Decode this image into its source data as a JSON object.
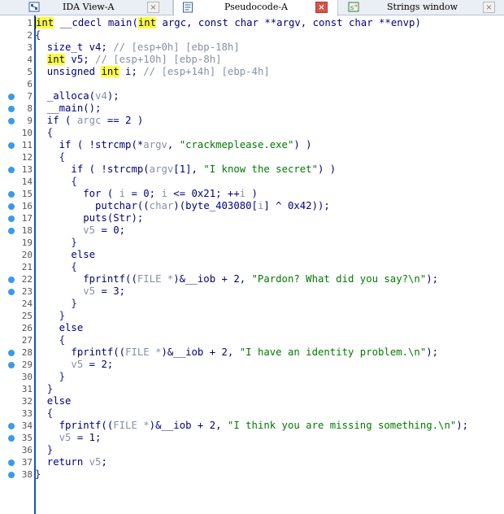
{
  "tabs": [
    {
      "label": "IDA View-A",
      "icon": "ida-view-icon",
      "active": false
    },
    {
      "label": "Pseudocode-A",
      "icon": "pseudocode-icon",
      "active": true
    },
    {
      "label": "Strings window",
      "icon": "strings-icon",
      "active": false
    }
  ],
  "close_glyph": "×",
  "code": {
    "line_numbers": [
      "1",
      "2",
      "3",
      "4",
      "5",
      "6",
      "7",
      "8",
      "9",
      "10",
      "11",
      "12",
      "13",
      "14",
      "15",
      "16",
      "17",
      "18",
      "19",
      "20",
      "21",
      "22",
      "23",
      "24",
      "25",
      "26",
      "27",
      "28",
      "29",
      "30",
      "31",
      "32",
      "33",
      "34",
      "35",
      "36",
      "37",
      "38"
    ],
    "l1": {
      "kw": "int",
      "rest": " __cdecl main(",
      "kw2": "int",
      "rest2": " argc, const char **argv, const char **envp)"
    },
    "l2": "{",
    "l3": {
      "a": "  size_t v4; ",
      "c": "// [esp+0h] [ebp-18h]"
    },
    "l4": {
      "ind": "  ",
      "kw": "int",
      "a": " v5; ",
      "c": "// [esp+10h] [ebp-8h]"
    },
    "l5": {
      "a": "  unsigned ",
      "kw": "int",
      "b": " i; ",
      "c": "// [esp+14h] [ebp-4h]"
    },
    "l7": {
      "a": "  _alloca(",
      "g": "v4",
      "b": ");"
    },
    "l8": "  __main();",
    "l9": {
      "a": "  if ( ",
      "g": "argc",
      "b": " == 2 )"
    },
    "l10": "  {",
    "l11": {
      "a": "    if ( !strcmp(*",
      "g": "argv",
      "b": ", ",
      "s": "\"crackmeplease.exe\"",
      "c": ") )"
    },
    "l12": "    {",
    "l13": {
      "a": "      if ( !strcmp(",
      "g": "argv",
      "b": "[1], ",
      "s": "\"I know the secret\"",
      "c": ") )"
    },
    "l14": "      {",
    "l15": {
      "a": "        for ( ",
      "g1": "i",
      "b": " = 0; ",
      "g2": "i",
      "c": " <= 0x21; ++",
      "g3": "i",
      "d": " )"
    },
    "l16": {
      "a": "          putchar((",
      "g1": "char",
      "b": ")(byte_403080[",
      "g2": "i",
      "c": "] ^ 0x42));"
    },
    "l17": "        puts(Str);",
    "l18": {
      "ind": "        ",
      "g": "v5",
      "b": " = 0;"
    },
    "l19": "      }",
    "l20": "      else",
    "l21": "      {",
    "l22": {
      "a": "        fprintf((",
      "g": "FILE *",
      "b": ")&__iob + 2, ",
      "s": "\"Pardon? What did you say?\\n\"",
      "c": ");"
    },
    "l23": {
      "ind": "        ",
      "g": "v5",
      "b": " = 3;"
    },
    "l24": "      }",
    "l25": "    }",
    "l26": "    else",
    "l27": "    {",
    "l28": {
      "a": "      fprintf((",
      "g": "FILE *",
      "b": ")&__iob + 2, ",
      "s": "\"I have an identity problem.\\n\"",
      "c": ");"
    },
    "l29": {
      "ind": "      ",
      "g": "v5",
      "b": " = 2;"
    },
    "l30": "    }",
    "l31": "  }",
    "l32": "  else",
    "l33": "  {",
    "l34": {
      "a": "    fprintf((",
      "g": "FILE *",
      "b": ")&__iob + 2, ",
      "s": "\"I think you are missing something.\\n\"",
      "c": ");"
    },
    "l35": {
      "ind": "    ",
      "g": "v5",
      "b": " = 1;"
    },
    "l36": "  }",
    "l37": {
      "a": "  return ",
      "g": "v5",
      "b": ";"
    },
    "l38": "}"
  },
  "breakpoint_color": "#3a9be8",
  "keyword_highlight_color": "#ffff33"
}
